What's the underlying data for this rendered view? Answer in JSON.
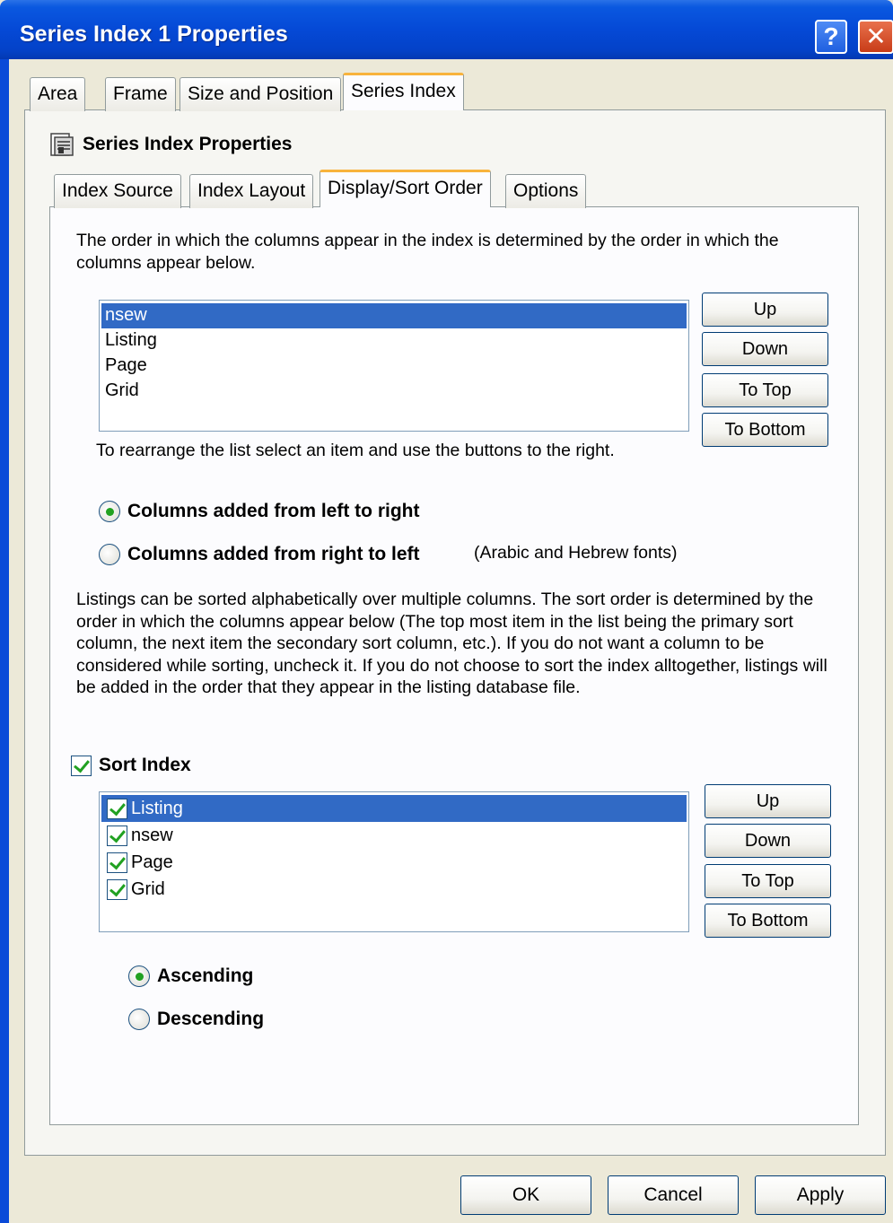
{
  "window": {
    "title": "Series Index 1 Properties",
    "help_glyph": "?",
    "close_glyph": "✕"
  },
  "outer_tabs": [
    "Area",
    "Frame",
    "Size and Position",
    "Series Index"
  ],
  "section": {
    "title": "Series Index Properties",
    "icon": "document-icon"
  },
  "inner_tabs": [
    "Index Source",
    "Index Layout",
    "Display/Sort Order",
    "Options"
  ],
  "display": {
    "intro": "The order in which the columns appear in the index is determined by the order in which the columns appear below.",
    "columns": [
      "nsew",
      "Listing",
      "Page",
      "Grid"
    ],
    "selected_index": 0,
    "buttons": {
      "up": "Up",
      "down": "Down",
      "top": "To Top",
      "bottom": "To Bottom"
    },
    "hint": "To rearrange the list select an item and use the buttons to the right.",
    "ltr_label": "Columns added from left to right",
    "rtl_label": "Columns added from right to left",
    "rtl_note": "(Arabic and Hebrew fonts)",
    "direction": "ltr"
  },
  "sort": {
    "explanation": "Listings can be sorted alphabetically over multiple columns.  The sort order is determined by the order in which the columns appear below (The top most item in the list being the primary sort column, the next item the secondary sort column, etc.).  If you do not want a column to be considered while sorting, uncheck it.  If you do not choose to sort the index alltogether, listings will be added in the order that they appear in the listing database file.",
    "sort_index_label": "Sort Index",
    "sort_index_checked": true,
    "columns": [
      {
        "label": "Listing",
        "checked": true
      },
      {
        "label": "nsew",
        "checked": true
      },
      {
        "label": "Page",
        "checked": true
      },
      {
        "label": "Grid",
        "checked": true
      }
    ],
    "selected_index": 0,
    "buttons": {
      "up": "Up",
      "down": "Down",
      "top": "To Top",
      "bottom": "To Bottom"
    },
    "ascending_label": "Ascending",
    "descending_label": "Descending",
    "order": "ascending"
  },
  "footer": {
    "ok": "OK",
    "cancel": "Cancel",
    "apply": "Apply"
  }
}
